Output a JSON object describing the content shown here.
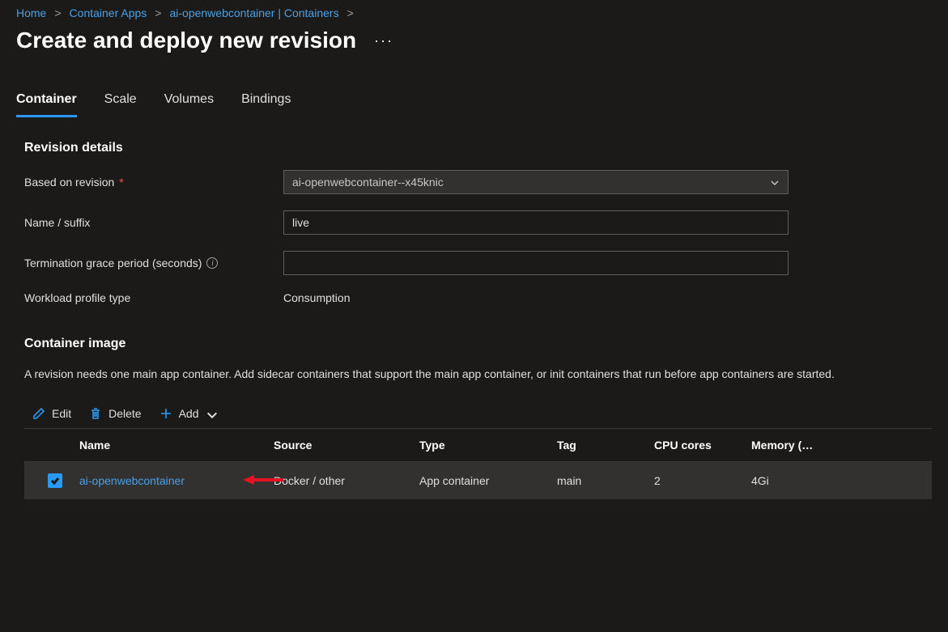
{
  "breadcrumb": {
    "items": [
      "Home",
      "Container Apps",
      "ai-openwebcontainer | Containers"
    ]
  },
  "page": {
    "title": "Create and deploy new revision"
  },
  "tabs": {
    "items": [
      {
        "label": "Container",
        "active": true
      },
      {
        "label": "Scale",
        "active": false
      },
      {
        "label": "Volumes",
        "active": false
      },
      {
        "label": "Bindings",
        "active": false
      }
    ]
  },
  "revision_details": {
    "heading": "Revision details",
    "labels": {
      "based_on": "Based on revision",
      "name_suffix": "Name / suffix",
      "term_grace": "Termination grace period (seconds)",
      "workload": "Workload profile type"
    },
    "values": {
      "based_on_selected": "ai-openwebcontainer--x45knic",
      "name_suffix": "live",
      "term_grace": "",
      "workload": "Consumption"
    }
  },
  "container_image": {
    "heading": "Container image",
    "description": "A revision needs one main app container. Add sidecar containers that support the main app container, or init containers that run before app containers are started."
  },
  "toolbar": {
    "edit": "Edit",
    "delete": "Delete",
    "add": "Add"
  },
  "table": {
    "headers": {
      "name": "Name",
      "source": "Source",
      "type": "Type",
      "tag": "Tag",
      "cpu": "CPU cores",
      "memory": "Memory (…"
    },
    "rows": [
      {
        "checked": true,
        "name": "ai-openwebcontainer",
        "source": "Docker / other",
        "type": "App container",
        "tag": "main",
        "cpu": "2",
        "memory": "4Gi"
      }
    ]
  }
}
